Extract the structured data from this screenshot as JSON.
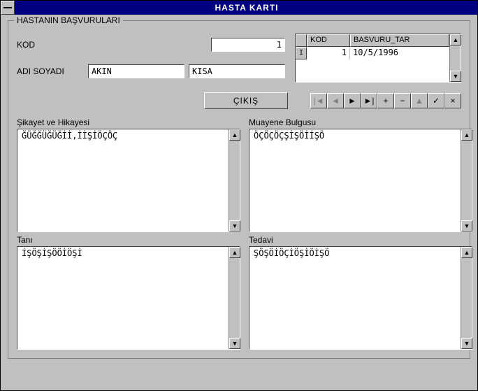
{
  "window": {
    "title": "HASTA KARTI"
  },
  "groupbox": {
    "title": "HASTANIN BAŞVURULARI"
  },
  "fields": {
    "kod_label": "KOD",
    "kod_value": "1",
    "adsoyad_label": "ADI SOYADI",
    "ad_value": "AKIN",
    "soyad_value": "KISA"
  },
  "grid": {
    "header_kod": "KOD",
    "header_tar": "BASVURU_TAR",
    "row_kod": "1",
    "row_tar": "10/5/1996",
    "row_marker": "I"
  },
  "actions": {
    "cikis": "ÇIKIŞ"
  },
  "nav": {
    "first": "|◄",
    "prev": "◄",
    "next": "►",
    "last": "►|",
    "insert": "+",
    "delete": "−",
    "edit": "▲",
    "post": "✓",
    "cancel": "×"
  },
  "panes": {
    "sikayet_label": "Şikayet ve Hikayesi",
    "sikayet_text": "ĞÜĞĞÜĞÜĞİİ,İİŞİÖÇÖÇ",
    "muayene_label": "Muayene Bulgusu",
    "muayene_text": "ÖÇÖÇÖÇŞİŞÖİİŞÖ",
    "tani_label": "Tanı",
    "tani_text": "İŞÖŞİŞÖÖİÖŞİ",
    "tedavi_label": "Tedavi",
    "tedavi_text": "ŞÖŞÖİÖÇİÖŞİÖİŞÖ"
  },
  "scroll": {
    "up": "▲",
    "down": "▼"
  }
}
